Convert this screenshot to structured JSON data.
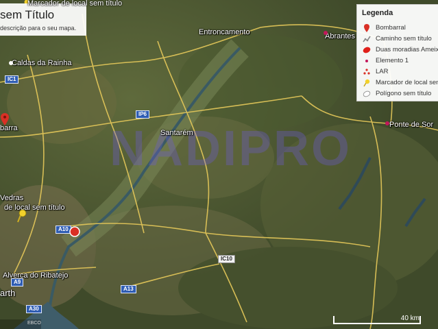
{
  "map": {
    "title": "sem Título",
    "description": "descrição para o seu mapa.",
    "top_marker_label": "Marcador de local sem título",
    "watermark": "NADIPRO",
    "attribution": "EBCO",
    "scale_label": "40 km"
  },
  "places": {
    "caldas": "Caldas da Rainha",
    "entroncamento": "Entroncamento",
    "abrantes": "Abrantes",
    "santarem": "Santarém",
    "ponte_sor": "Ponte de Sor",
    "bombarral": "barra",
    "vedras": "Vedras",
    "local_sem_titulo": "de local sem título",
    "alverca": "Alverca do Ribatejo",
    "earth": "arth"
  },
  "roads": {
    "ic1": "IC1",
    "ip6": "IP6",
    "a10": "A10",
    "ic10": "IC10",
    "a9": "A9",
    "a13": "A13",
    "a30": "A30",
    "badge": "A10"
  },
  "legend": {
    "title": "Legenda",
    "items": [
      {
        "label": "Bombarral",
        "icon": "red-pin-icon",
        "color": "#d93025"
      },
      {
        "label": "Caminho sem título",
        "icon": "path-icon",
        "color": "#888888"
      },
      {
        "label": "Duas moradias Ameixoeira",
        "icon": "red-polygon-icon",
        "color": "#e0201a"
      },
      {
        "label": "Elemento 1",
        "icon": "small-dot-icon",
        "color": "#c2185b"
      },
      {
        "label": "LAR",
        "icon": "cluster-dots-icon",
        "color": "#d93025"
      },
      {
        "label": "Marcador de local sem título",
        "icon": "yellow-pin-icon",
        "color": "#f3d22b"
      },
      {
        "label": "Polígono sem título",
        "icon": "empty-polygon-icon",
        "color": "#ffffff"
      }
    ]
  }
}
